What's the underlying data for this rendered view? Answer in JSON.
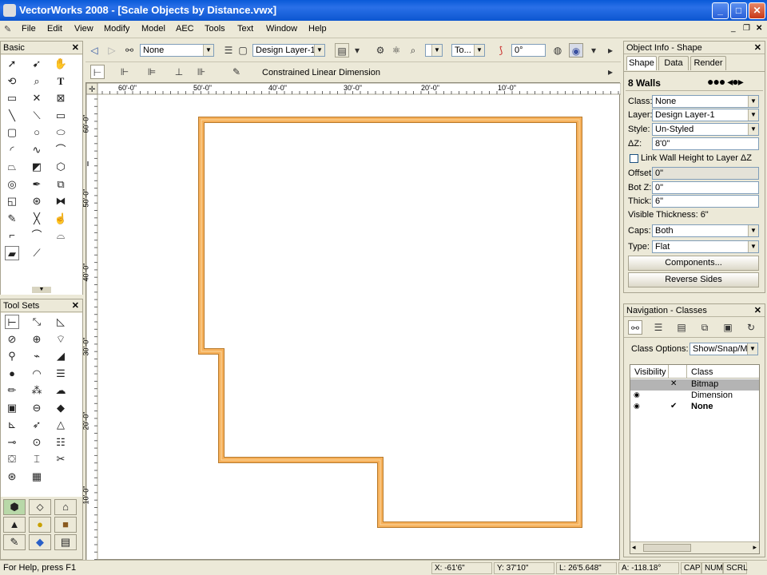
{
  "window": {
    "title": "VectorWorks 2008 - [Scale Objects by Distance.vwx]"
  },
  "menu": [
    "File",
    "Edit",
    "View",
    "Modify",
    "Model",
    "AEC",
    "Tools",
    "Text",
    "Window",
    "Help"
  ],
  "palettes": {
    "basic": {
      "title": "Basic"
    },
    "toolsets": {
      "title": "Tool Sets"
    }
  },
  "toolbar": {
    "class_value": "None",
    "layer_value": "Design Layer-1",
    "to_label": "To...",
    "angle_value": "0°"
  },
  "mode_bar": {
    "label": "Constrained Linear Dimension"
  },
  "ruler": {
    "top_ticks": [
      "60'-0\"",
      "50'-0\"",
      "40'-0\"",
      "30'-0\"",
      "20'-0\"",
      "10'-0\""
    ],
    "left_ticks": [
      "60'-0\"",
      "50'-0\"",
      "40'-0\"",
      "30'-0\"",
      "20'-0\"",
      "10'-0\""
    ]
  },
  "object_info": {
    "title": "Object Info - Shape",
    "tabs": [
      "Shape",
      "Data",
      "Render"
    ],
    "object_name": "8 Walls",
    "fields": {
      "class_label": "Class:",
      "class_value": "None",
      "layer_label": "Layer:",
      "layer_value": "Design Layer-1",
      "style_label": "Style:",
      "style_value": "Un-Styled",
      "dz_label": "ΔZ:",
      "dz_value": "8'0\"",
      "link_label": "Link Wall Height to Layer ΔZ",
      "offset_label": "Offset:",
      "offset_value": "0\"",
      "botz_label": "Bot Z:",
      "botz_value": "0\"",
      "thick_label": "Thick:",
      "thick_value": "6\"",
      "visible_thickness": "Visible Thickness: 6\"",
      "caps_label": "Caps:",
      "caps_value": "Both",
      "type_label": "Type:",
      "type_value": "Flat"
    },
    "buttons": {
      "components": "Components...",
      "reverse": "Reverse Sides"
    }
  },
  "navigation": {
    "title": "Navigation - Classes",
    "class_options_label": "Class Options:",
    "class_options_value": "Show/Snap/M",
    "col_visibility": "Visibility",
    "col_class": "Class",
    "rows": [
      {
        "name": "Bitmap",
        "mark": "✕",
        "selected": true,
        "bold": false
      },
      {
        "name": "Dimension",
        "mark": "",
        "selected": false,
        "bold": false
      },
      {
        "name": "None",
        "mark": "✔",
        "selected": false,
        "bold": true
      }
    ]
  },
  "status": {
    "help": "For Help, press F1",
    "x": "X: -61'6\"",
    "y": "Y: 37'10\"",
    "l": "L: 26'5.648\"",
    "a": "A: -118.18°",
    "cap": "CAP",
    "num": "NUM",
    "scrl": "SCRL"
  },
  "colors": {
    "wall_fill": "#f6b05a",
    "wall_stroke": "#b87a2c",
    "titlebar": "#0a5ad8",
    "selection": "#b4b4b4"
  }
}
